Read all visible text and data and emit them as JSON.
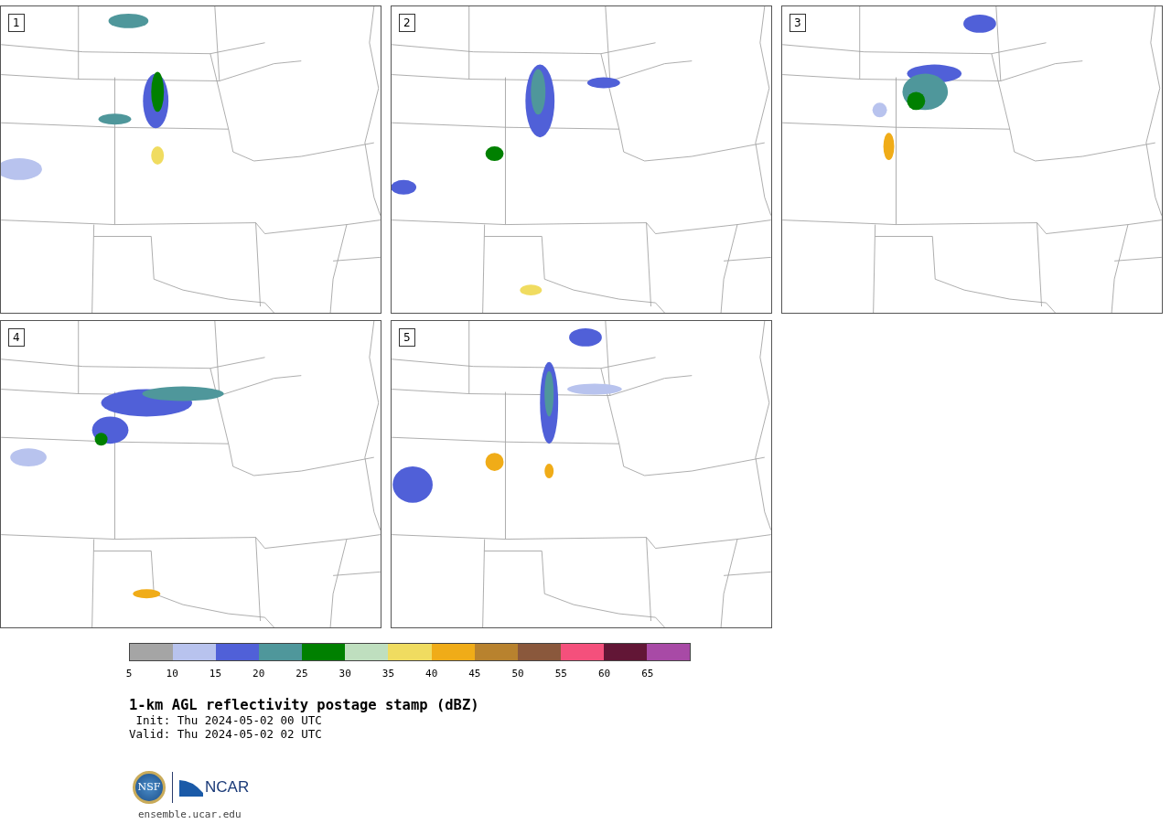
{
  "panels": [
    {
      "label": "1"
    },
    {
      "label": "2"
    },
    {
      "label": "3"
    },
    {
      "label": "4"
    },
    {
      "label": "5"
    }
  ],
  "colorbar": {
    "segments": [
      {
        "color": "#a5a5a5"
      },
      {
        "color": "#b8c3ee"
      },
      {
        "color": "#5060d8"
      },
      {
        "color": "#4f979b"
      },
      {
        "color": "#008000"
      },
      {
        "color": "#bfdfbf"
      },
      {
        "color": "#f0dc60"
      },
      {
        "color": "#f0ac18"
      },
      {
        "color": "#b8822e"
      },
      {
        "color": "#8a583c"
      },
      {
        "color": "#f4507c"
      },
      {
        "color": "#621636"
      },
      {
        "color": "#a84aa6"
      }
    ],
    "ticks": [
      "5",
      "10",
      "15",
      "20",
      "25",
      "30",
      "35",
      "40",
      "45",
      "50",
      "55",
      "60",
      "65"
    ]
  },
  "title": "1-km AGL reflectivity postage stamp (dBZ)",
  "init": " Init: Thu 2024-05-02 00 UTC",
  "valid": "Valid: Thu 2024-05-02 02 UTC",
  "logos": {
    "left": "NSF",
    "right": "NCAR"
  },
  "footer": "ensemble.ucar.edu"
}
